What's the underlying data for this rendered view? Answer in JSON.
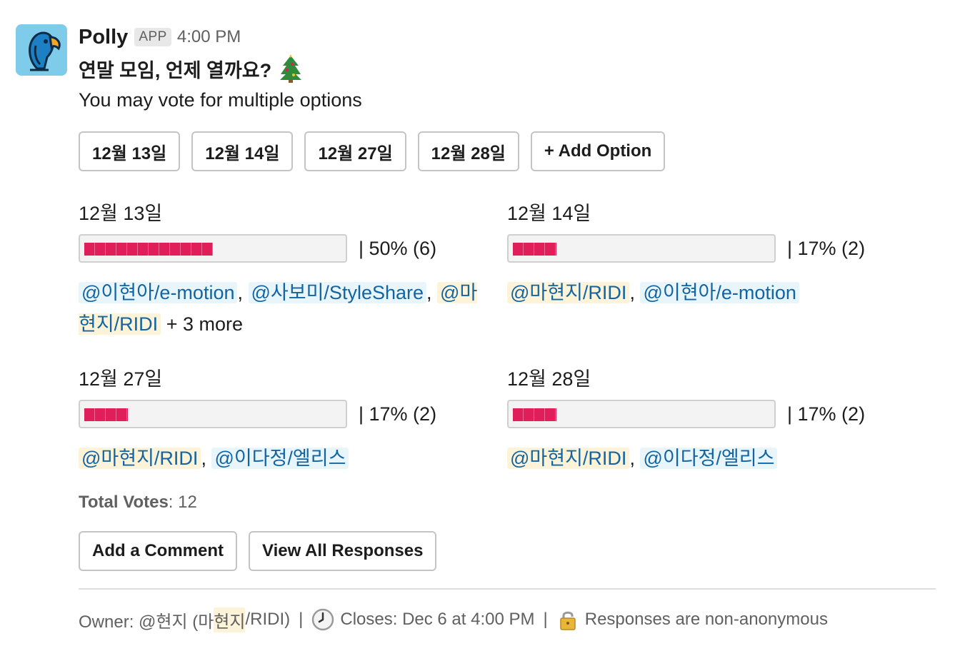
{
  "message": {
    "app_name": "Polly",
    "app_badge": "APP",
    "timestamp": "4:00 PM",
    "question": "연말 모임, 언제 열까요?",
    "question_emoji": "christmas-tree-icon",
    "subtitle": "You may vote for multiple options"
  },
  "option_buttons": [
    "12월 13일",
    "12월 14일",
    "12월 27일",
    "12월 28일",
    "+ Add Option"
  ],
  "results": [
    {
      "label": "12월 13일",
      "fraction": 0.5,
      "pct_text": "|  50% (6)",
      "voters": [
        {
          "name": "@이현아/e-motion",
          "highlight": false
        },
        {
          "name": "@사보미/StyleShare",
          "highlight": false
        },
        {
          "name": "@마현지/RIDI",
          "highlight": true
        }
      ],
      "more": "+ 3 more"
    },
    {
      "label": "12월 14일",
      "fraction": 0.17,
      "pct_text": "|  17% (2)",
      "voters": [
        {
          "name": "@마현지/RIDI",
          "highlight": true
        },
        {
          "name": "@이현아/e-motion",
          "highlight": false
        }
      ],
      "more": ""
    },
    {
      "label": "12월 27일",
      "fraction": 0.17,
      "pct_text": "|  17% (2)",
      "voters": [
        {
          "name": "@마현지/RIDI",
          "highlight": true
        },
        {
          "name": "@이다정/엘리스",
          "highlight": false
        }
      ],
      "more": ""
    },
    {
      "label": "12월 28일",
      "fraction": 0.17,
      "pct_text": "|  17% (2)",
      "voters": [
        {
          "name": "@마현지/RIDI",
          "highlight": true
        },
        {
          "name": "@이다정/엘리스",
          "highlight": false
        }
      ],
      "more": ""
    }
  ],
  "total": {
    "label": "Total Votes",
    "sep": ":",
    "value": "12"
  },
  "actions": {
    "comment": "Add a Comment",
    "view_all": "View All Responses"
  },
  "footer": {
    "owner_prefix": "Owner: @현지 (마",
    "owner_highlight": "현지",
    "owner_suffix": "/RIDI)",
    "separator": "|",
    "closes_icon": "clock-icon",
    "closes": "Closes: Dec 6 at 4:00 PM",
    "lock_icon": "lock-icon",
    "anonymity": "Responses are non-anonymous"
  },
  "colors": {
    "bar_fill": "#e01e5a",
    "mention_text": "#1264a3",
    "mention_bg": "#e8f5fa",
    "mention_highlight_bg": "#fdf3d8",
    "avatar_bg": "#7fcbea"
  }
}
